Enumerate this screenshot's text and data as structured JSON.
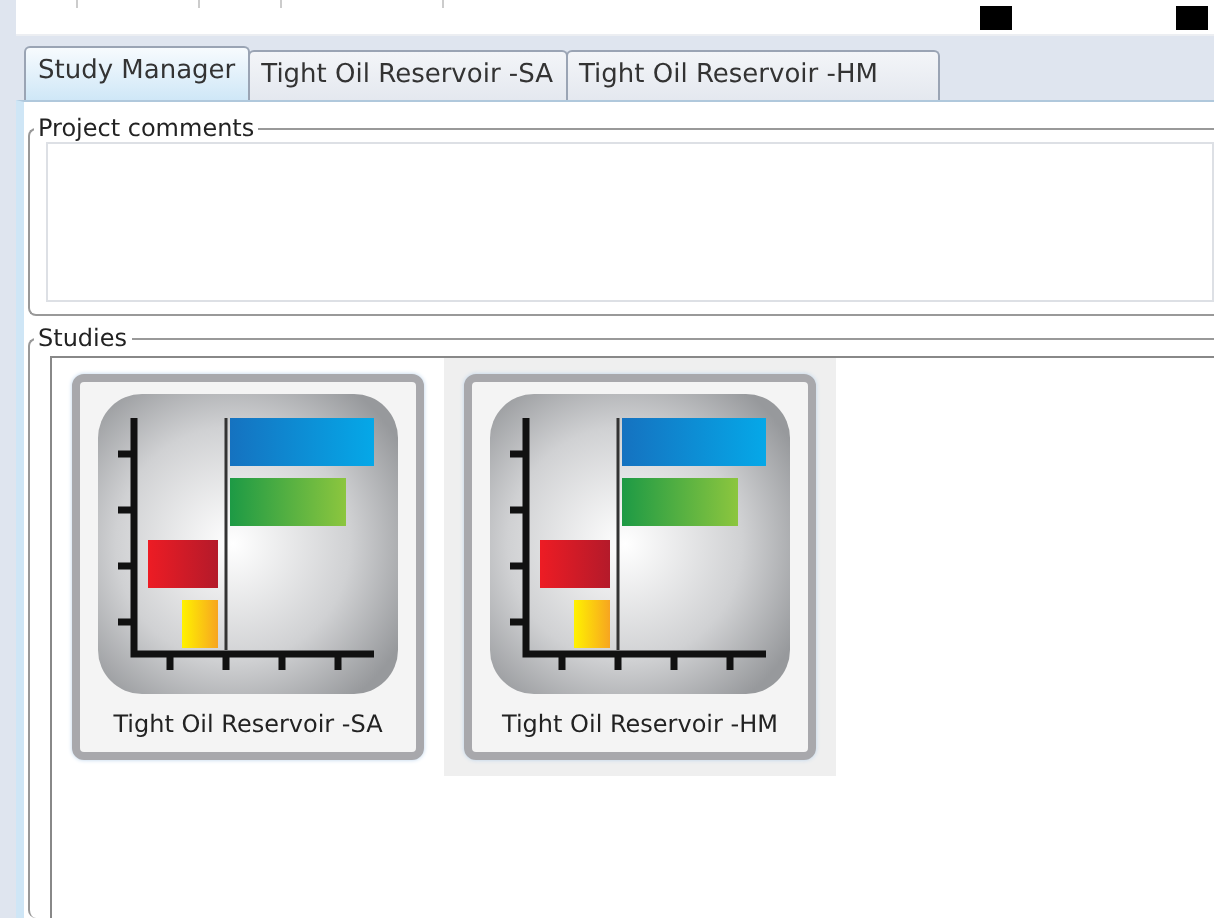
{
  "tabs": [
    {
      "label": "Study Manager",
      "selected": true
    },
    {
      "label": "Tight Oil Reservoir -SA",
      "selected": false
    },
    {
      "label": "Tight Oil Reservoir -HM",
      "selected": false
    }
  ],
  "project_comments": {
    "title": "Project comments"
  },
  "studies": {
    "title": "Studies",
    "items": [
      {
        "label": "Tight Oil Reservoir -SA",
        "selected": false
      },
      {
        "label": "Tight Oil Reservoir -HM",
        "selected": true
      }
    ]
  }
}
